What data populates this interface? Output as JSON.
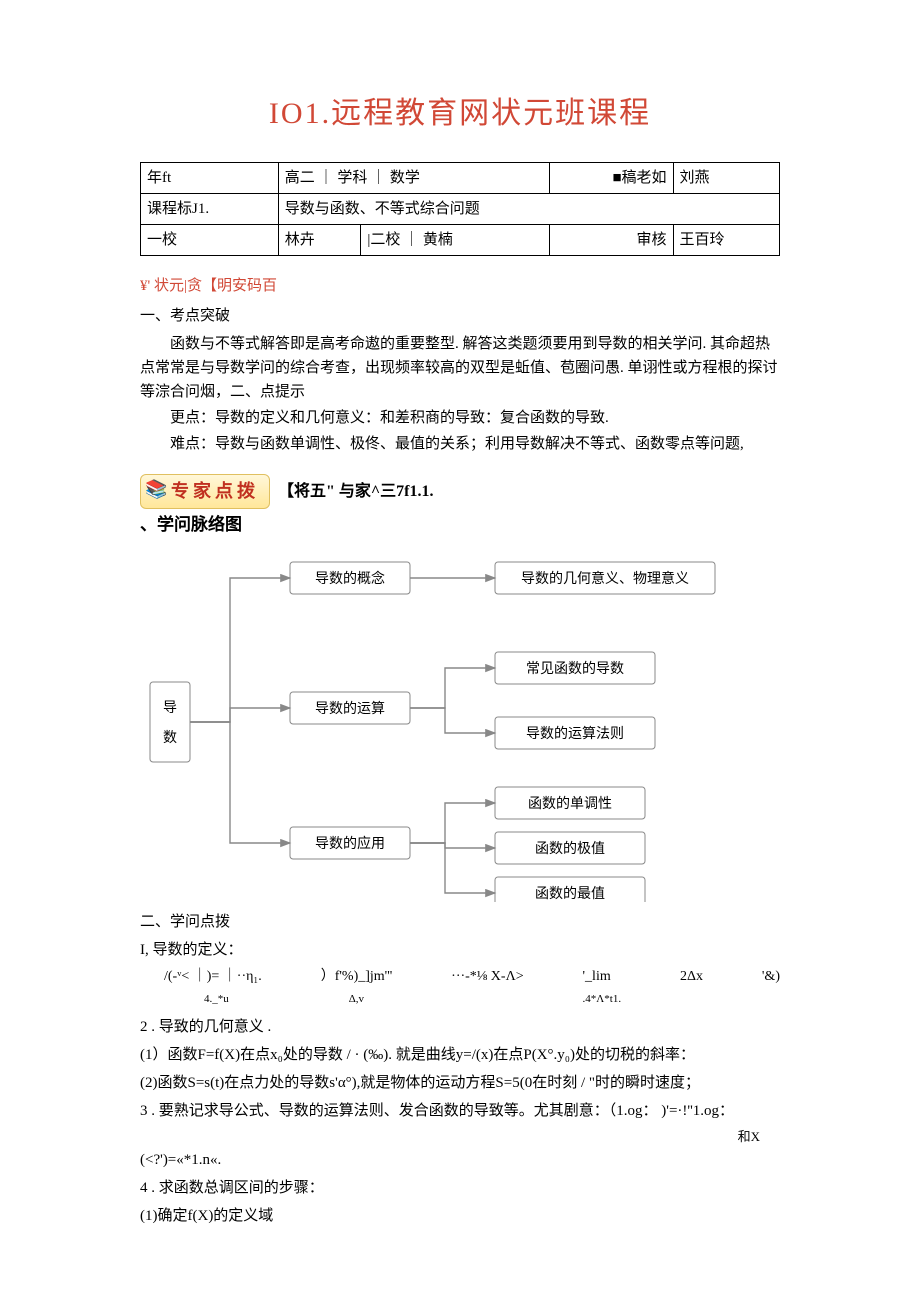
{
  "title": "IO1.远程教育网状元班课程",
  "metaTable": {
    "r1": {
      "c1": "年ft",
      "c2": "高二",
      "c3": "学科",
      "c4": "数学",
      "c5": "■稿老如",
      "c6": "刘燕"
    },
    "r2": {
      "c1": "课程标J1.",
      "c2": "导数与函数、不等式综合问题"
    },
    "r3": {
      "c1": "一校",
      "c2": "林卉",
      "c3": "|二校",
      "c4": "黄楠",
      "c5": "审核",
      "c6": "王百玲"
    }
  },
  "status_line": "¥' 状元|贪【明安码百",
  "sec1_title": "一、考点突破",
  "sec1_p1": "函数与不等式解答即是高考命遨的重要整型. 解答这类题须要用到导数的相关学问. 其命超热点常常是与导数学问的综合考查，出现频率较高的双型是蚯值、苞圈问愚. 单诩性或方程根的探讨等淙合问烟，二、点提示",
  "sec1_p2": "更点：导数的定义和几何意义：和差积商的导致：复合函数的导致.",
  "sec1_p3": "难点：导数与函数单调性、极佟、最值的关系；利用导数解决不等式、函数零点等问题,",
  "expert_badge": "专家点拨",
  "expert_sub": "【将五\" 与家^三7f1.1.",
  "kmap_title": "、学问脉络图",
  "kmap": {
    "root": "导数",
    "mid1": "导数的概念",
    "mid2": "导数的运算",
    "mid3": "导数的应用",
    "leaf1": "导数的几何意义、物理意义",
    "leaf2a": "常见函数的导数",
    "leaf2b": "导数的运算法则",
    "leaf3a": "函数的单调性",
    "leaf3b": "函数的极值",
    "leaf3c": "函数的最值"
  },
  "sec2_title": "二、学问点拨",
  "pt1_title": "I, 导数的定义：",
  "formula": {
    "a": "/(-ᵛ< ｜)= ｜··η₁.",
    "a2": "4._*u",
    "b": "）f'%)_]jm'''",
    "b2": "Δ,v",
    "c": "···-*⅛  X-Λ>",
    "d": "'_lim",
    "d2": ".4*Λ*t1.",
    "e": "2Δx",
    "f": "'&)"
  },
  "pt2_title": "2 . 导致的几何意义 .",
  "pt2_a": "(1）函数F=f(X)在点x₀处的导数 / · (‰). 就是曲线y=/(x)在点P(X°.y₀)处的切税的斜率：",
  "pt2_b": "(2)函数S=s(t)在点力处的导数s'α°),就是物体的运动方程S=5(0在时刻 / \"时的瞬时速度；",
  "pt3_a": "3 . 要熟记求导公式、导数的运算法则、发合函数的导致等。尤其剧意：（1.og： )'=·!''1.og：",
  "pt3_b": "和X",
  "pt3_c": "(<?')=«*1.n«.",
  "pt4_title": "4 . 求函数总调区间的步骤：",
  "pt4_a": "(1)确定f(X)的定义域"
}
